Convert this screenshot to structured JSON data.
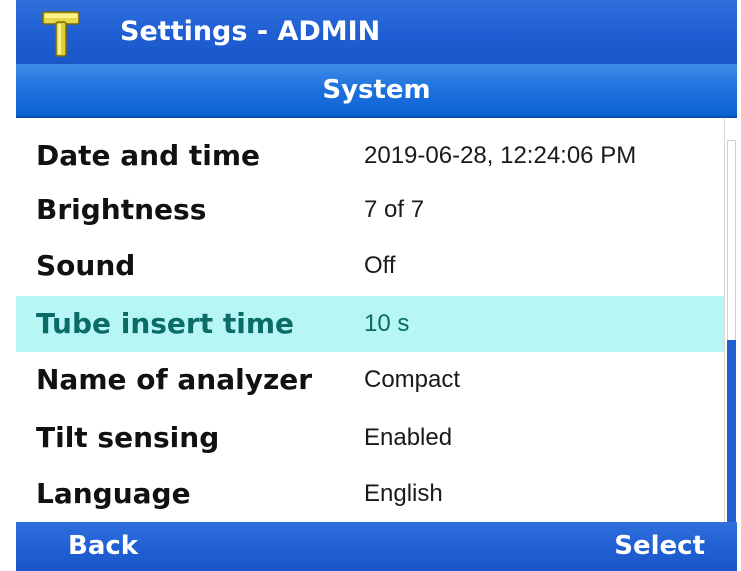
{
  "titlebar": {
    "title": "Settings - ADMIN",
    "icon": "hammer-icon"
  },
  "subheader": {
    "title": "System"
  },
  "settings": {
    "rows": [
      {
        "label": "Date and time",
        "value": "2019-06-28, 12:24:06 PM",
        "selected": false
      },
      {
        "label": "Brightness",
        "value": "7 of 7",
        "selected": false
      },
      {
        "label": "Sound",
        "value": "Off",
        "selected": false
      },
      {
        "label": "Tube insert time",
        "value": "10 s",
        "selected": true
      },
      {
        "label": "Name of analyzer",
        "value": "Compact",
        "selected": false
      },
      {
        "label": "Tilt sensing",
        "value": "Enabled",
        "selected": false
      },
      {
        "label": "Language",
        "value": "English",
        "selected": false
      }
    ]
  },
  "softkeys": {
    "left": "Back",
    "right": "Select"
  },
  "colors": {
    "header_blue": "#1f5ed2",
    "selected_row": "#b6f6f5",
    "selected_text": "#0b6b66"
  }
}
